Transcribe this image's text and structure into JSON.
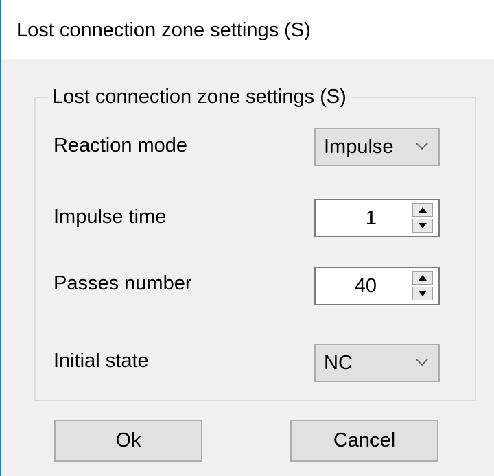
{
  "window": {
    "title": "Lost connection zone settings (S)"
  },
  "group": {
    "legend": "Lost connection zone settings (S)",
    "fields": [
      {
        "label": "Reaction mode",
        "type": "combo",
        "value": "Impulse"
      },
      {
        "label": "Impulse time",
        "type": "spin",
        "value": "1"
      },
      {
        "label": "Passes number",
        "type": "spin",
        "value": "40"
      },
      {
        "label": "Initial state",
        "type": "combo",
        "value": "NC"
      }
    ]
  },
  "buttons": {
    "ok": "Ok",
    "cancel": "Cancel"
  },
  "icons": {
    "combo_arrow": "chevron-down-icon",
    "spin_up": "triangle-up-icon",
    "spin_down": "triangle-down-icon"
  },
  "colors": {
    "window_border": "#1979ca",
    "dialog_background": "#f0f0f0",
    "button_face": "#e1e1e1"
  }
}
